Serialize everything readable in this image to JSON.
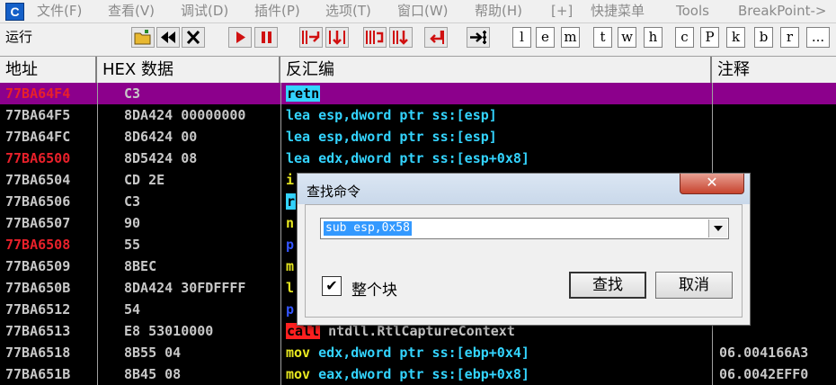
{
  "menu": {
    "items": [
      "文件(F)",
      "查看(V)",
      "调试(D)",
      "插件(P)",
      "选项(T)",
      "窗口(W)",
      "帮助(H)",
      "[+]",
      "快捷菜单",
      "Tools",
      "BreakPoint->"
    ],
    "app_icon_letter": "C"
  },
  "toolbar": {
    "status": "运行",
    "letters": [
      "l",
      "e",
      "m",
      "t",
      "w",
      "h",
      "c",
      "P",
      "k",
      "b",
      "r",
      "..."
    ]
  },
  "columns": {
    "address": "地址",
    "hex": "HEX 数据",
    "disasm": "反汇编",
    "comment": "注释"
  },
  "rows": [
    {
      "addr": "77BA64F4",
      "hex": "C3",
      "op": "retn",
      "args": "",
      "comment": ""
    },
    {
      "addr": "77BA64F5",
      "hex": "8DA424 00000000",
      "op": "lea",
      "args": "esp,dword ptr ss:[esp]",
      "comment": ""
    },
    {
      "addr": "77BA64FC",
      "hex": "8D6424 00",
      "op": "lea",
      "args": "esp,dword ptr ss:[esp]",
      "comment": ""
    },
    {
      "addr": "77BA6500",
      "hex": "8D5424 08",
      "op": "lea",
      "args": "edx,dword ptr ss:[esp+0x8]",
      "comment": ""
    },
    {
      "addr": "77BA6504",
      "hex": "CD 2E",
      "op": "i",
      "args": "",
      "comment": ""
    },
    {
      "addr": "77BA6506",
      "hex": "C3",
      "op": "r",
      "args": "",
      "comment": ""
    },
    {
      "addr": "77BA6507",
      "hex": "90",
      "op": "n",
      "args": "",
      "comment": ""
    },
    {
      "addr": "77BA6508",
      "hex": "55",
      "op": "p",
      "args": "",
      "comment": ""
    },
    {
      "addr": "77BA6509",
      "hex": "8BEC",
      "op": "m",
      "args": "",
      "comment": ""
    },
    {
      "addr": "77BA650B",
      "hex": "8DA424 30FDFFFF",
      "op": "l",
      "args": "",
      "comment": ""
    },
    {
      "addr": "77BA6512",
      "hex": "54",
      "op": "p",
      "args": "",
      "comment": ""
    },
    {
      "addr": "77BA6513",
      "hex": "E8 53010000",
      "op": "call",
      "args": "ntdll.RtlCaptureContext",
      "comment": ""
    },
    {
      "addr": "77BA6518",
      "hex": "8B55 04",
      "op": "mov",
      "args": "edx,dword ptr ss:[ebp+0x4]",
      "comment": "06.004166A3"
    },
    {
      "addr": "77BA651B",
      "hex": "8B45 08",
      "op": "mov",
      "args": "eax,dword ptr ss:[ebp+0x8]",
      "comment": "06.0042EFF0"
    }
  ],
  "dialog": {
    "title": "查找命令",
    "close_glyph": "✕",
    "query": "sub esp,0x58",
    "checkbox_label": "整个块",
    "checkbox_mark": "✔",
    "find_label": "查找",
    "cancel_label": "取消"
  }
}
